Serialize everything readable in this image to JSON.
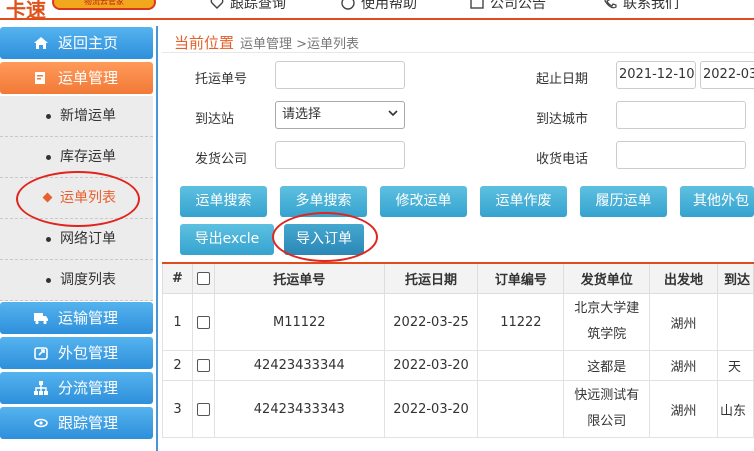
{
  "header": {
    "logo_mark": "卡速",
    "logo_badge": "物流云管家",
    "nav": [
      {
        "label": "跟踪查询",
        "icon": "heart-icon"
      },
      {
        "label": "使用帮助",
        "icon": "help-icon"
      },
      {
        "label": "公司公告",
        "icon": "announcement-icon"
      },
      {
        "label": "联系我们",
        "icon": "phone-icon"
      }
    ]
  },
  "sidebar": {
    "home": "返回主页",
    "waybill_mgmt": "运单管理",
    "sub_items": [
      "新增运单",
      "库存运单",
      "运单列表",
      "网络订单",
      "调度列表"
    ],
    "transport_mgmt": "运输管理",
    "outsource_mgmt": "外包管理",
    "branch_mgmt": "分流管理",
    "tracking_mgmt": "跟踪管理"
  },
  "breadcrumb": {
    "label": "当前位置",
    "path": "运单管理 >运单列表"
  },
  "form": {
    "waybill_no_label": "托运单号",
    "waybill_no_value": "",
    "start_date_label": "起止日期",
    "start_date": "2021-12-10",
    "end_date": "2022-03",
    "dest_station_label": "到达站",
    "dest_station_value": "请选择",
    "dest_city_label": "到达城市",
    "dest_city_value": "",
    "shipper_label": "发货公司",
    "shipper_value": "",
    "receiver_phone_label": "收货电话",
    "receiver_phone_value": ""
  },
  "buttons": {
    "search": "运单搜索",
    "multi_search": "多单搜索",
    "edit": "修改运单",
    "void": "运单作废",
    "history": "履历运单",
    "other": "其他外包",
    "export": "导出excle",
    "import": "导入订单"
  },
  "table": {
    "headers": [
      "#",
      "",
      "托运单号",
      "托运日期",
      "订单编号",
      "发货单位",
      "出发地",
      "到达"
    ],
    "rows": [
      {
        "idx": "1",
        "waybill": "M11122",
        "date": "2022-03-25",
        "order": "11222",
        "shipper": "北京大学建筑学院",
        "origin": "湖州",
        "dest": ""
      },
      {
        "idx": "2",
        "waybill": "42423433344",
        "date": "2022-03-20",
        "order": "",
        "shipper": "这都是",
        "origin": "湖州",
        "dest": "天"
      },
      {
        "idx": "3",
        "waybill": "42423433343",
        "date": "2022-03-20",
        "order": "",
        "shipper": "快远测试有限公司",
        "origin": "湖州",
        "dest": "山东"
      }
    ]
  },
  "colors": {
    "accent": "#e2622c",
    "sidebar_blue": "#2e8fdb",
    "button": "#35a3cf",
    "annotation": "#e0251e"
  }
}
